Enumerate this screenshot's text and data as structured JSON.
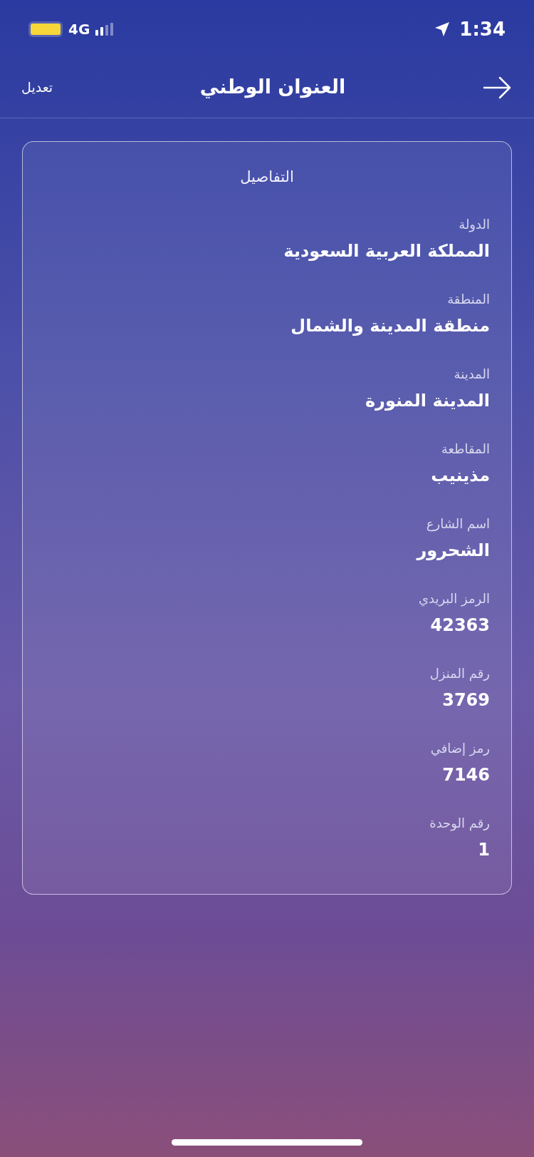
{
  "status_bar": {
    "network": "4G",
    "time": "1:34"
  },
  "header": {
    "title": "العنوان الوطني",
    "edit_label": "تعديل"
  },
  "card": {
    "title": "التفاصيل",
    "fields": [
      {
        "label": "الدولة",
        "value": "المملكة العربية السعودية"
      },
      {
        "label": "المنطقة",
        "value": "منطقة المدينة والشمال"
      },
      {
        "label": "المدينة",
        "value": "المدينة المنورة"
      },
      {
        "label": "المقاطعة",
        "value": "مذينيب"
      },
      {
        "label": "اسم الشارع",
        "value": "الشحرور"
      },
      {
        "label": "الرمز البريدي",
        "value": "42363"
      },
      {
        "label": "رقم المنزل",
        "value": "3769"
      },
      {
        "label": "رمز إضافي",
        "value": "7146"
      },
      {
        "label": "رقم الوحدة",
        "value": "1"
      }
    ]
  }
}
